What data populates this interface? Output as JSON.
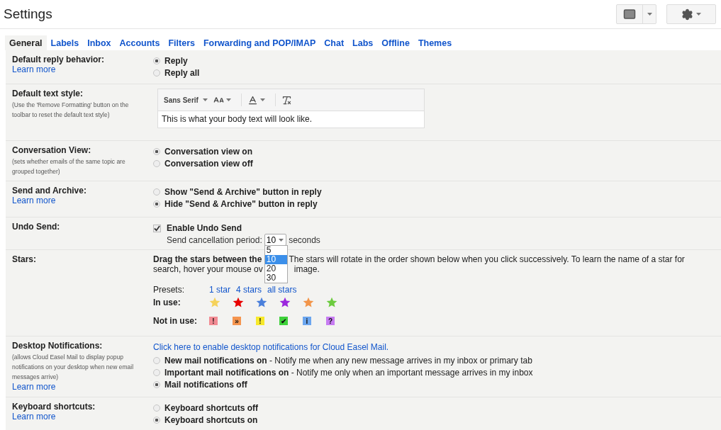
{
  "header": {
    "title": "Settings"
  },
  "tabs": [
    {
      "label": "General",
      "selected": true
    },
    {
      "label": "Labels",
      "selected": false
    },
    {
      "label": "Inbox",
      "selected": false
    },
    {
      "label": "Accounts",
      "selected": false
    },
    {
      "label": "Filters",
      "selected": false
    },
    {
      "label": "Forwarding and POP/IMAP",
      "selected": false
    },
    {
      "label": "Chat",
      "selected": false
    },
    {
      "label": "Labs",
      "selected": false
    },
    {
      "label": "Offline",
      "selected": false
    },
    {
      "label": "Themes",
      "selected": false
    }
  ],
  "sections": [
    {
      "kind": "radio",
      "label": "Default reply behavior:",
      "learn_more": "Learn more",
      "options": [
        {
          "label": "Reply",
          "selected": true
        },
        {
          "label": "Reply all",
          "selected": false
        }
      ]
    },
    {
      "kind": "text_style",
      "label": "Default text style:",
      "note": "(Use the 'Remove Formatting' button on the toolbar to reset the default text style)",
      "font": "Sans Serif",
      "preview": "This is what your body text will look like."
    },
    {
      "kind": "radio",
      "label": "Conversation View:",
      "note": "(sets whether emails of the same topic are grouped together)",
      "options": [
        {
          "label": "Conversation view on",
          "selected": true
        },
        {
          "label": "Conversation view off",
          "selected": false
        }
      ]
    },
    {
      "kind": "radio",
      "label": "Send and Archive:",
      "learn_more": "Learn more",
      "options": [
        {
          "label": "Show \"Send & Archive\" button in reply",
          "selected": false
        },
        {
          "label": "Hide \"Send & Archive\" button in reply",
          "selected": true
        }
      ]
    },
    {
      "kind": "undo_send",
      "label": "Undo Send:",
      "checkbox": {
        "label": "Enable Undo Send",
        "checked": true
      },
      "period_label": "Send cancellation period:",
      "value": "10",
      "suffix": "seconds",
      "dropdown": [
        {
          "label": "5",
          "selected": false
        },
        {
          "label": "10",
          "selected": true
        },
        {
          "label": "20",
          "selected": false
        },
        {
          "label": "30",
          "selected": false
        }
      ]
    },
    {
      "kind": "stars",
      "label": "Stars:",
      "line1_bold": "Drag the stars between the",
      "line1_rest": "The stars will rotate in the order shown below when you click successively. To learn the name of a star for",
      "line2_start": "search, hover your mouse ov",
      "line2_end": "image.",
      "presets_label": "Presets:",
      "presets": [
        "1 star",
        "4 stars",
        "all stars"
      ],
      "in_use_label": "In use:",
      "in_use": [
        {
          "color": "#f5d25a"
        },
        {
          "color": "#e80000"
        },
        {
          "color": "#4a7fdb"
        },
        {
          "color": "#9b27dd"
        },
        {
          "color": "#f2954a"
        },
        {
          "color": "#6ccb3f"
        }
      ],
      "not_in_use_label": "Not in use:",
      "not_in_use": [
        {
          "glyph": "!",
          "color": "#f28b93"
        },
        {
          "glyph": "»",
          "color": "#f5954f"
        },
        {
          "glyph": "!",
          "color": "#f7e92a"
        },
        {
          "glyph": "✔",
          "color": "#3ed13a"
        },
        {
          "glyph": "i",
          "color": "#6ba6ef"
        },
        {
          "glyph": "?",
          "color": "#c77cf2"
        }
      ]
    },
    {
      "kind": "notifications",
      "label": "Desktop Notifications:",
      "note": "(allows Cloud Easel Mail to display popup notifications on your desktop when new email messages arrive)",
      "learn_more": "Learn more",
      "link": "Click here to enable desktop notifications for Cloud Easel Mail.",
      "options": [
        {
          "label": "**New mail notifications on** - Notify me when any new message arrives in my inbox or primary tab",
          "selected": false
        },
        {
          "label": "**Important mail notifications on** - Notify me only when an important message arrives in my inbox",
          "selected": false
        },
        {
          "label": "**Mail notifications off**",
          "selected": true
        }
      ]
    },
    {
      "kind": "radio",
      "label": "Keyboard shortcuts:",
      "learn_more": "Learn more",
      "options": [
        {
          "label": "Keyboard shortcuts off",
          "selected": false
        },
        {
          "label": "Keyboard shortcuts on",
          "selected": true
        }
      ]
    }
  ]
}
